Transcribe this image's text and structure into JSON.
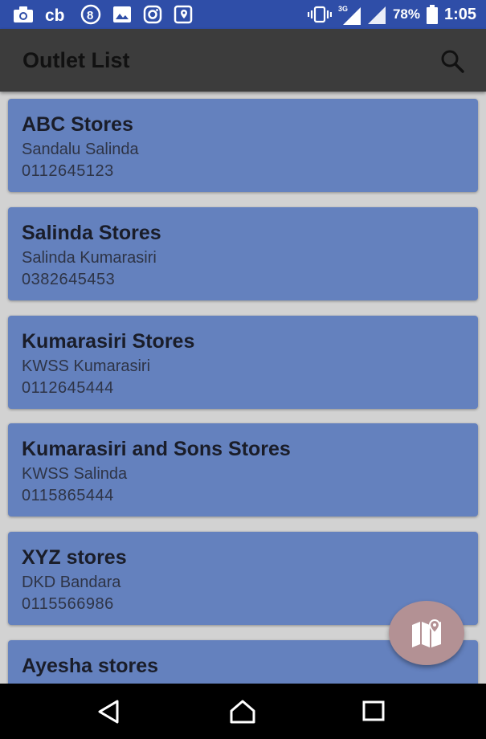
{
  "status_bar": {
    "battery_percent": "78%",
    "time": "1:05",
    "network_label": "3G",
    "left_icons": [
      "camera-icon",
      "cb-app-icon",
      "circle-8-icon",
      "gallery-icon",
      "instagram-icon",
      "map-pin-icon"
    ],
    "right_icons": [
      "vibrate-icon",
      "signal-3g-icon",
      "signal-icon",
      "battery-icon"
    ]
  },
  "toolbar": {
    "title": "Outlet List",
    "search_icon": "search-icon"
  },
  "outlets": [
    {
      "name": "ABC Stores",
      "owner": "Sandalu Salinda",
      "phone": "0112645123"
    },
    {
      "name": "Salinda Stores",
      "owner": "Salinda Kumarasiri",
      "phone": "0382645453"
    },
    {
      "name": "Kumarasiri Stores",
      "owner": "KWSS Kumarasiri",
      "phone": "0112645444"
    },
    {
      "name": "Kumarasiri and Sons Stores",
      "owner": "KWSS Salinda",
      "phone": "0115865444"
    },
    {
      "name": "XYZ stores",
      "owner": "DKD Bandara",
      "phone": "0115566986"
    },
    {
      "name": "Ayesha stores"
    }
  ],
  "fab": {
    "icon": "map-icon"
  },
  "nav_bar": {
    "icons": [
      "back-icon",
      "home-icon",
      "recents-icon"
    ]
  },
  "colors": {
    "status_bar": "#2f4ea8",
    "toolbar": "#3c3c3c",
    "card": "#6481be",
    "fab": "#b39194",
    "background": "#d2d2d2"
  }
}
